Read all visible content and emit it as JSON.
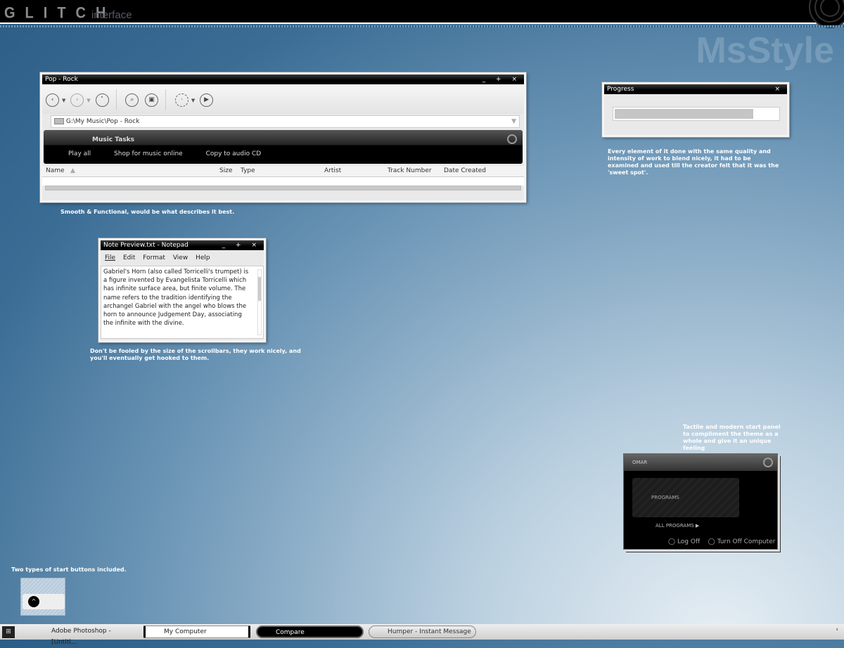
{
  "header": {
    "logo": "GLITCH",
    "logo_sub": "interface",
    "watermark": "MsStyle"
  },
  "explorer": {
    "title": "Pop - Rock",
    "controls": "_ + ×",
    "address": "G:\\My Music\\Pop - Rock",
    "tasks_title": "Music Tasks",
    "tasks": [
      "Play all",
      "Shop for music online",
      "Copy to audio CD"
    ],
    "columns": [
      "Name",
      "Size",
      "Type",
      "Artist",
      "Track Number",
      "Date Created"
    ],
    "caption": "Smooth & Functional, would be what describes it best."
  },
  "notepad": {
    "title": "Note Preview.txt - Notepad",
    "controls": "_ + ×",
    "menu": [
      "File",
      "Edit",
      "Format",
      "View",
      "Help"
    ],
    "text": "Gabriel's Horn (also called Torricelli's trumpet) is a figure invented by Evangelista Torricelli which has infinite surface area, but finite volume. The name refers to the tradition identifying the archangel Gabriel with the angel who blows the horn to announce Judgement Day, associating the infinite with the divine.",
    "caption": "Don't be fooled by the size of the scrollbars, they work nicely, and you'll eventually get hooked to them."
  },
  "progress": {
    "title": "Progress",
    "close": "×",
    "percent": 85,
    "caption": "Every element of it done with the same quality and intensity of work to blend nicely, it had to be examined and used till the creator felt that it was the 'sweet spot'."
  },
  "start_panel": {
    "caption": "Tactile and modern start panel to compliment the theme as a whole and give it an unique feeling",
    "user": "OMAR",
    "programs": "PROGRAMS",
    "all_programs": "ALL PROGRAMS",
    "log_off": "Log Off",
    "turn_off": "Turn Off Computer"
  },
  "start_buttons": {
    "caption": "Two types of start buttons included."
  },
  "taskbar": {
    "items": [
      "Adobe Photoshop - [Untitl...",
      "My Computer",
      "Compare",
      "Humper - Instant Message"
    ]
  }
}
